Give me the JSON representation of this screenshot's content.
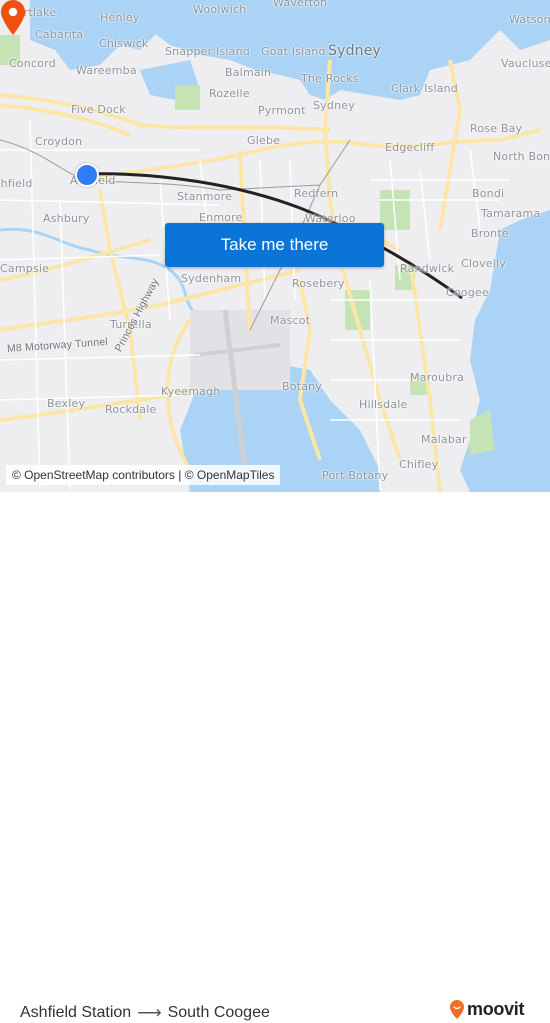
{
  "map": {
    "places": [
      {
        "name": "Mortlake"
      },
      {
        "name": "Henley"
      },
      {
        "name": "Woolwich"
      },
      {
        "name": "Waverton"
      },
      {
        "name": "Watson"
      },
      {
        "name": "Cabarita"
      },
      {
        "name": "Chiswick"
      },
      {
        "name": "Snapper Island"
      },
      {
        "name": "Goat Island"
      },
      {
        "name": "Sydney"
      },
      {
        "name": "Vaucluse"
      },
      {
        "name": "Concord"
      },
      {
        "name": "Wareemba"
      },
      {
        "name": "Balmain"
      },
      {
        "name": "The Rocks"
      },
      {
        "name": "Clark Island"
      },
      {
        "name": "Rozelle"
      },
      {
        "name": "Five Dock"
      },
      {
        "name": "Pyrmont"
      },
      {
        "name": "Sydney"
      },
      {
        "name": "Rose Bay"
      },
      {
        "name": "Croydon"
      },
      {
        "name": "Glebe"
      },
      {
        "name": "Edgecliff"
      },
      {
        "name": "North Bondi"
      },
      {
        "name": "Ashfield"
      },
      {
        "name": "Stanmore"
      },
      {
        "name": "Redfern"
      },
      {
        "name": "Bondi"
      },
      {
        "name": "Ashbury"
      },
      {
        "name": "Enmore"
      },
      {
        "name": "Waterloo"
      },
      {
        "name": "Tamarama"
      },
      {
        "name": "Bronte"
      },
      {
        "name": "Campsie"
      },
      {
        "name": "Sydenham"
      },
      {
        "name": "Randwick"
      },
      {
        "name": "Clovelly"
      },
      {
        "name": "Rosebery"
      },
      {
        "name": "Coogee"
      },
      {
        "name": "Turrella"
      },
      {
        "name": "Mascot"
      },
      {
        "name": "M8 Motorway Tunnel"
      },
      {
        "name": "Princes Highway"
      },
      {
        "name": "Maroubra"
      },
      {
        "name": "Botany"
      },
      {
        "name": "Kyeemagh"
      },
      {
        "name": "Bexley"
      },
      {
        "name": "Rockdale"
      },
      {
        "name": "Hillsdale"
      },
      {
        "name": "Malabar"
      },
      {
        "name": "Chifley"
      },
      {
        "name": "Port Botany"
      },
      {
        "name": "Ashfield"
      }
    ],
    "cta_label": "Take me there",
    "attribution": "© OpenStreetMap contributors | © OpenMapTiles",
    "origin_icon": "origin-dot-icon",
    "destination_icon": "destination-pin-icon"
  },
  "footer": {
    "origin": "Ashfield Station",
    "arrow_icon": "arrow-right-icon",
    "destination": "South Coogee",
    "brand": "moovit"
  },
  "colors": {
    "accent": "#0a75d6",
    "origin": "#2e7cf6",
    "destination": "#f0500f",
    "water": "#aad3f5",
    "park": "#c6e3b5",
    "road": "#fbe6a8",
    "land": "#eeeef0",
    "route": "#222222"
  }
}
